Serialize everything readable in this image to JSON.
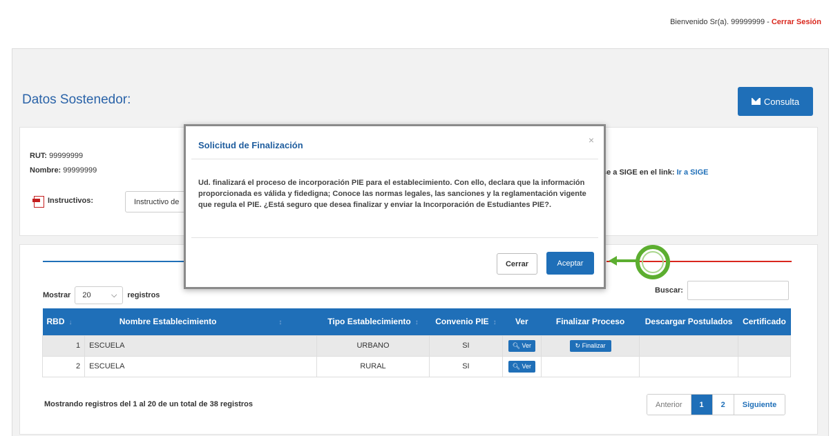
{
  "topbar": {
    "welcome": "Bienvenido Sr(a). 99999999 - ",
    "logout": "Cerrar Sesión"
  },
  "page": {
    "title": "Datos Sostenedor:"
  },
  "header": {
    "consulta_label": "Consulta"
  },
  "info": {
    "rut_label": "RUT:",
    "rut_value": "99999999",
    "nombre_label": "Nombre:",
    "nombre_value": "99999999",
    "sige_text": "se a SIGE en el link:",
    "sige_link": "Ir a SIGE",
    "instructivos_label": "Instructivos:",
    "instructivo_select": "Instructivo de"
  },
  "table": {
    "mostrar_label": "Mostrar",
    "mostrar_value": "20",
    "registros_label": "registros",
    "buscar_label": "Buscar:",
    "headers": [
      "RBD",
      "Nombre Establecimiento",
      "Tipo Establecimiento",
      "Convenio PIE",
      "Ver",
      "Finalizar Proceso",
      "Descargar Postulados",
      "Certificado"
    ],
    "rows": [
      {
        "rbd": "1",
        "nombre": "ESCUELA",
        "tipo": "URBANO",
        "convenio": "SI",
        "ver": "Ver",
        "finalizar": "Finalizar"
      },
      {
        "rbd": "2",
        "nombre": "ESCUELA",
        "tipo": "RURAL",
        "convenio": "SI",
        "ver": "Ver",
        "finalizar": ""
      }
    ],
    "summary": "Mostrando registros del 1 al 20 de un total de 38 registros",
    "pager": {
      "prev": "Anterior",
      "pages": [
        "1",
        "2"
      ],
      "next": "Siguiente",
      "active_page": "1"
    }
  },
  "modal": {
    "title": "Solicitud de Finalización",
    "close": "×",
    "body": "Ud. finalizará el proceso de incorporación PIE para el establecimiento. Con ello, declara que la información proporcionada es válida y fidedigna; Conoce las normas legales, las sanciones y la reglamentación vigente que regula el PIE. ¿Está seguro que desea finalizar y enviar la Incorporación de Estudiantes PIE?.",
    "cerrar": "Cerrar",
    "aceptar": "Aceptar"
  },
  "colors": {
    "primary": "#1f6fb8",
    "danger": "#d9261c",
    "highlight": "#5cae30"
  }
}
